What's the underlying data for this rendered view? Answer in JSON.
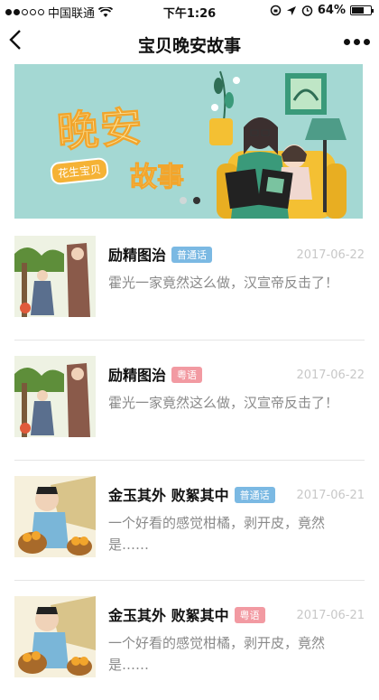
{
  "status_bar": {
    "carrier": "中国联通",
    "time": "下午1:26",
    "battery_percent": "64%",
    "battery_level": 0.64
  },
  "nav": {
    "back_icon": "chevron-left-icon",
    "title": "宝贝晚安故事",
    "more_icon": "more-dots-icon"
  },
  "banner": {
    "title": "晚安",
    "subtitle": "故事",
    "brand": "花生宝贝",
    "slides": 2,
    "active_slide": 2
  },
  "colors": {
    "badge_mandarin": "#7bb9e3",
    "badge_cantonese": "#f29aa2",
    "date": "#c8c8c8",
    "desc": "#8a8a8a"
  },
  "items": [
    {
      "title": "励精图治",
      "badge": "普通话",
      "badge_color": "blue",
      "date": "2017-06-22",
      "desc": "霍光一家竟然这么做，汉宣帝反击了！"
    },
    {
      "title": "励精图治",
      "badge": "粤语",
      "badge_color": "pink",
      "date": "2017-06-22",
      "desc": "霍光一家竟然这么做，汉宣帝反击了！"
    },
    {
      "title": "金玉其外 败絮其中",
      "badge": "普通话",
      "badge_color": "blue",
      "date": "2017-06-21",
      "desc": "一个好看的感觉柑橘，剥开皮，竟然是……"
    },
    {
      "title": "金玉其外 败絮其中",
      "badge": "粤语",
      "badge_color": "pink",
      "date": "2017-06-21",
      "desc": "一个好看的感觉柑橘，剥开皮，竟然是……"
    }
  ]
}
